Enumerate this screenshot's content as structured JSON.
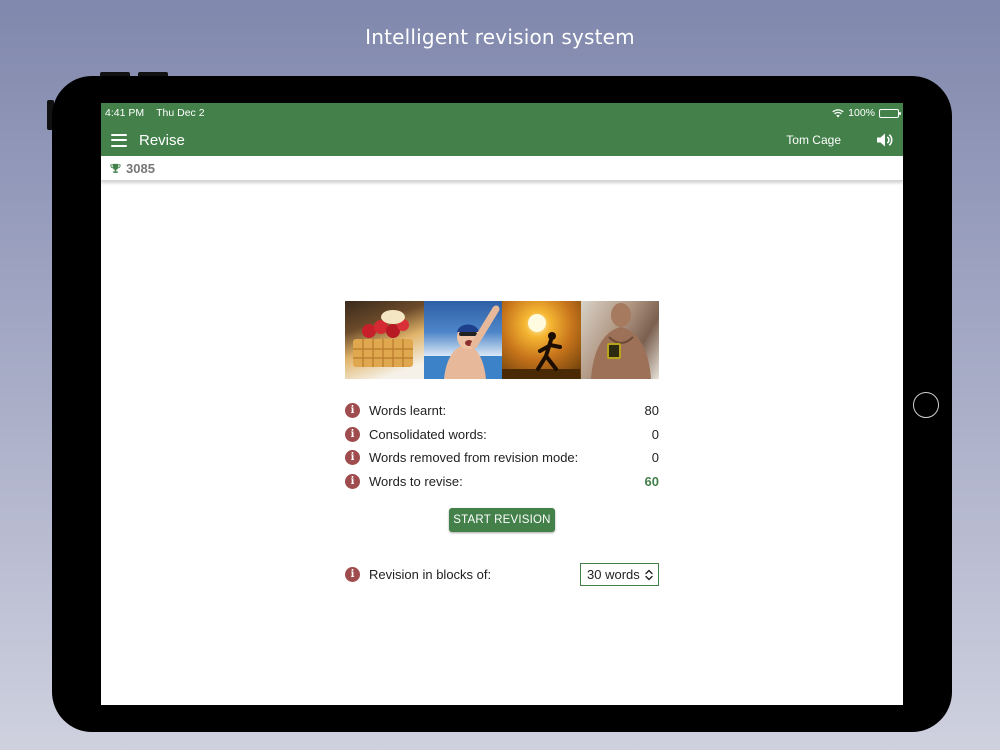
{
  "headline": "Intelligent revision system",
  "status_bar": {
    "time": "4:41 PM",
    "date": "Thu Dec 2",
    "battery": "100%"
  },
  "app_bar": {
    "title": "Revise",
    "user_name": "Tom Cage"
  },
  "score": "3085",
  "stats": [
    {
      "label": "Words learnt:",
      "value": "80"
    },
    {
      "label": "Consolidated words:",
      "value": "0"
    },
    {
      "label": "Words removed from revision mode:",
      "value": "0"
    },
    {
      "label": "Words to revise:",
      "value": "60"
    }
  ],
  "start_button": "START REVISION",
  "blocks": {
    "label": "Revision in blocks of:",
    "selected": "30 words"
  },
  "info_glyph": "i",
  "colors": {
    "accent": "#43804a",
    "info": "#9e4c4e"
  },
  "icons": [
    "menu-icon",
    "speaker-icon",
    "trophy-icon",
    "info-icon",
    "wifi-icon",
    "battery-icon",
    "chevron-updown-icon"
  ]
}
